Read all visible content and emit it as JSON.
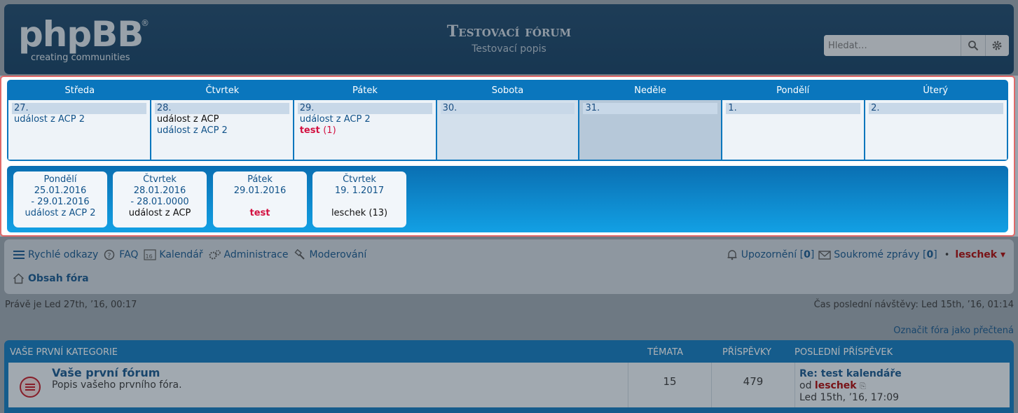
{
  "header": {
    "logo_text": "phpBB",
    "logo_reg": "®",
    "logo_tagline": "creating communities",
    "site_title": "Testovací fórum",
    "site_description": "Testovací popis",
    "search_placeholder": "Hledat…"
  },
  "calendar": {
    "days": [
      "Středa",
      "Čtvrtek",
      "Pátek",
      "Sobota",
      "Neděle",
      "Pondělí",
      "Úterý"
    ],
    "cells": [
      {
        "date": "27.",
        "ev1": "událost z ACP 2",
        "ev2": "",
        "ev3": ""
      },
      {
        "date": "28.",
        "ev1": "událost z ACP",
        "ev2": "událost z ACP 2",
        "ev3": ""
      },
      {
        "date": "29.",
        "ev1": "událost z ACP 2",
        "ev2": "test",
        "ev2_count": "(1)"
      },
      {
        "date": "30."
      },
      {
        "date": "31."
      },
      {
        "date": "1."
      },
      {
        "date": "2."
      }
    ]
  },
  "upcoming": [
    {
      "day": "Pondělí",
      "date1": "25.01.2016",
      "date2": "- 29.01.2016",
      "event": "událost z ACP 2"
    },
    {
      "day": "Čtvrtek",
      "date1": "28.01.2016",
      "date2": "- 28.01.0000",
      "event": "událost z ACP"
    },
    {
      "day": "Pátek",
      "date1": "29.01.2016",
      "date2": "",
      "event": "test"
    },
    {
      "day": "Čtvrtek",
      "date1": "19. 1.2017",
      "date2": "",
      "event": "leschek (13)"
    }
  ],
  "nav": {
    "quick_links": "Rychlé odkazy",
    "faq": "FAQ",
    "calendar": "Kalendář",
    "admin": "Administrace",
    "moderate": "Moderování",
    "notifications_label": "Upozornění",
    "notifications_count": "0",
    "pm_label": "Soukromé zprávy",
    "pm_count": "0",
    "username": "leschek",
    "board_index": "Obsah fóra"
  },
  "status": {
    "now": "Právě je Led 27th, ’16, 00:17",
    "last_visit": "Čas poslední návštěvy: Led 15th, ’16, 01:14",
    "mark_read": "Označit fóra jako přečtená"
  },
  "forum": {
    "category": "Vaše první kategorie",
    "col_topics": "Témata",
    "col_posts": "Příspěvky",
    "col_last": "Poslední příspěvek",
    "rows": [
      {
        "name": "Vaše první fórum",
        "description": "Popis vašeho prvního fóra.",
        "topics": "15",
        "posts": "479",
        "last_title": "Re: test kalendáře",
        "last_by_prefix": "od",
        "last_by": "leschek",
        "last_time": "Led 15th, ’16, 17:09"
      }
    ]
  }
}
